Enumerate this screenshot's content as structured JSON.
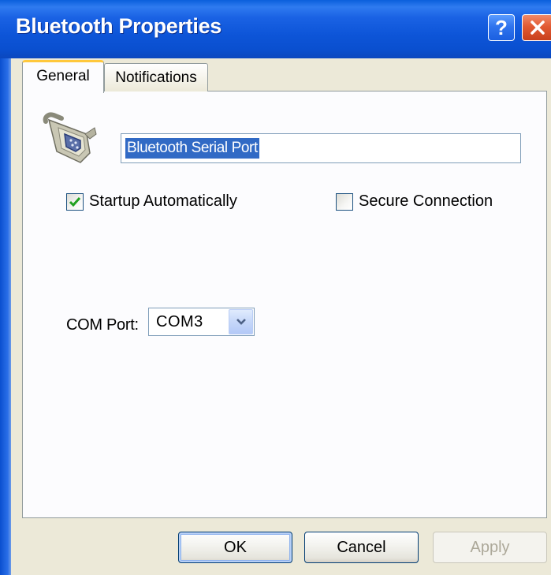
{
  "window": {
    "title": "Bluetooth Properties"
  },
  "titlebar_buttons": {
    "help_label": "?"
  },
  "tabs": [
    {
      "label": "General",
      "active": true
    },
    {
      "label": "Notifications",
      "active": false
    }
  ],
  "general": {
    "service_icon": "serial-port-connector-icon",
    "service_name": "Bluetooth Serial Port",
    "startup_automatically": {
      "label": "Startup Automatically",
      "checked": true
    },
    "secure_connection": {
      "label": "Secure Connection",
      "checked": false
    },
    "com_port": {
      "label": "COM Port:",
      "value": "COM3"
    }
  },
  "buttons": {
    "ok": "OK",
    "cancel": "Cancel",
    "apply": "Apply"
  },
  "colors": {
    "titlebar": "#0a55d8",
    "close_button": "#e25a32",
    "selection": "#316ac5",
    "checkmark": "#21a121"
  }
}
